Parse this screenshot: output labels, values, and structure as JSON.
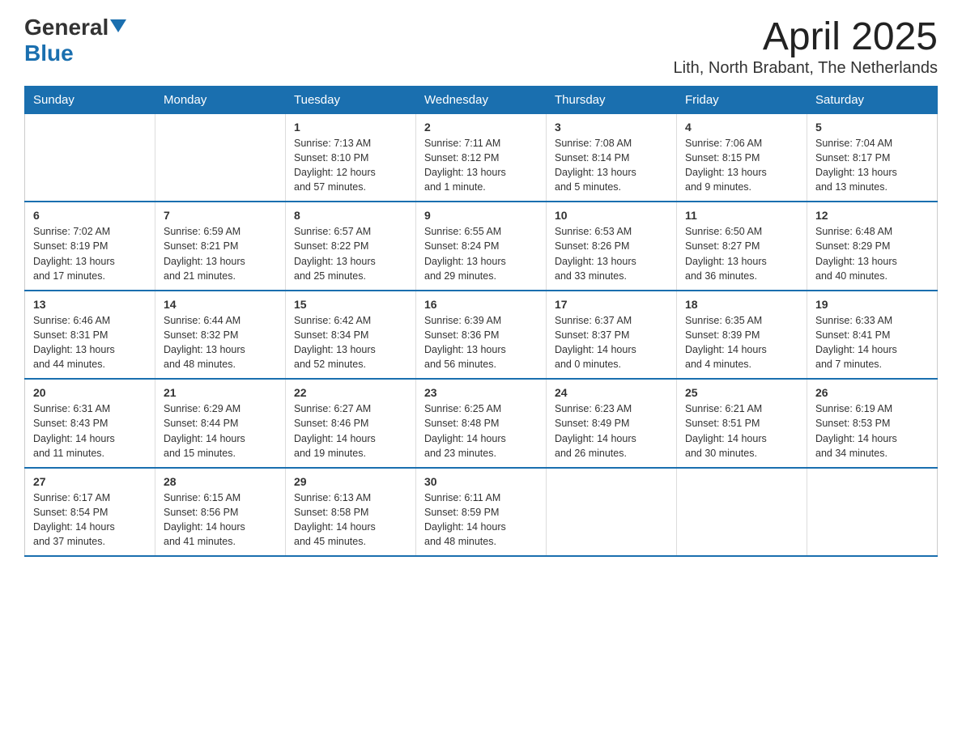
{
  "header": {
    "logo_general": "General",
    "logo_blue": "Blue",
    "title": "April 2025",
    "subtitle": "Lith, North Brabant, The Netherlands"
  },
  "days_of_week": [
    "Sunday",
    "Monday",
    "Tuesday",
    "Wednesday",
    "Thursday",
    "Friday",
    "Saturday"
  ],
  "weeks": [
    [
      {
        "day": "",
        "info": ""
      },
      {
        "day": "",
        "info": ""
      },
      {
        "day": "1",
        "info": "Sunrise: 7:13 AM\nSunset: 8:10 PM\nDaylight: 12 hours\nand 57 minutes."
      },
      {
        "day": "2",
        "info": "Sunrise: 7:11 AM\nSunset: 8:12 PM\nDaylight: 13 hours\nand 1 minute."
      },
      {
        "day": "3",
        "info": "Sunrise: 7:08 AM\nSunset: 8:14 PM\nDaylight: 13 hours\nand 5 minutes."
      },
      {
        "day": "4",
        "info": "Sunrise: 7:06 AM\nSunset: 8:15 PM\nDaylight: 13 hours\nand 9 minutes."
      },
      {
        "day": "5",
        "info": "Sunrise: 7:04 AM\nSunset: 8:17 PM\nDaylight: 13 hours\nand 13 minutes."
      }
    ],
    [
      {
        "day": "6",
        "info": "Sunrise: 7:02 AM\nSunset: 8:19 PM\nDaylight: 13 hours\nand 17 minutes."
      },
      {
        "day": "7",
        "info": "Sunrise: 6:59 AM\nSunset: 8:21 PM\nDaylight: 13 hours\nand 21 minutes."
      },
      {
        "day": "8",
        "info": "Sunrise: 6:57 AM\nSunset: 8:22 PM\nDaylight: 13 hours\nand 25 minutes."
      },
      {
        "day": "9",
        "info": "Sunrise: 6:55 AM\nSunset: 8:24 PM\nDaylight: 13 hours\nand 29 minutes."
      },
      {
        "day": "10",
        "info": "Sunrise: 6:53 AM\nSunset: 8:26 PM\nDaylight: 13 hours\nand 33 minutes."
      },
      {
        "day": "11",
        "info": "Sunrise: 6:50 AM\nSunset: 8:27 PM\nDaylight: 13 hours\nand 36 minutes."
      },
      {
        "day": "12",
        "info": "Sunrise: 6:48 AM\nSunset: 8:29 PM\nDaylight: 13 hours\nand 40 minutes."
      }
    ],
    [
      {
        "day": "13",
        "info": "Sunrise: 6:46 AM\nSunset: 8:31 PM\nDaylight: 13 hours\nand 44 minutes."
      },
      {
        "day": "14",
        "info": "Sunrise: 6:44 AM\nSunset: 8:32 PM\nDaylight: 13 hours\nand 48 minutes."
      },
      {
        "day": "15",
        "info": "Sunrise: 6:42 AM\nSunset: 8:34 PM\nDaylight: 13 hours\nand 52 minutes."
      },
      {
        "day": "16",
        "info": "Sunrise: 6:39 AM\nSunset: 8:36 PM\nDaylight: 13 hours\nand 56 minutes."
      },
      {
        "day": "17",
        "info": "Sunrise: 6:37 AM\nSunset: 8:37 PM\nDaylight: 14 hours\nand 0 minutes."
      },
      {
        "day": "18",
        "info": "Sunrise: 6:35 AM\nSunset: 8:39 PM\nDaylight: 14 hours\nand 4 minutes."
      },
      {
        "day": "19",
        "info": "Sunrise: 6:33 AM\nSunset: 8:41 PM\nDaylight: 14 hours\nand 7 minutes."
      }
    ],
    [
      {
        "day": "20",
        "info": "Sunrise: 6:31 AM\nSunset: 8:43 PM\nDaylight: 14 hours\nand 11 minutes."
      },
      {
        "day": "21",
        "info": "Sunrise: 6:29 AM\nSunset: 8:44 PM\nDaylight: 14 hours\nand 15 minutes."
      },
      {
        "day": "22",
        "info": "Sunrise: 6:27 AM\nSunset: 8:46 PM\nDaylight: 14 hours\nand 19 minutes."
      },
      {
        "day": "23",
        "info": "Sunrise: 6:25 AM\nSunset: 8:48 PM\nDaylight: 14 hours\nand 23 minutes."
      },
      {
        "day": "24",
        "info": "Sunrise: 6:23 AM\nSunset: 8:49 PM\nDaylight: 14 hours\nand 26 minutes."
      },
      {
        "day": "25",
        "info": "Sunrise: 6:21 AM\nSunset: 8:51 PM\nDaylight: 14 hours\nand 30 minutes."
      },
      {
        "day": "26",
        "info": "Sunrise: 6:19 AM\nSunset: 8:53 PM\nDaylight: 14 hours\nand 34 minutes."
      }
    ],
    [
      {
        "day": "27",
        "info": "Sunrise: 6:17 AM\nSunset: 8:54 PM\nDaylight: 14 hours\nand 37 minutes."
      },
      {
        "day": "28",
        "info": "Sunrise: 6:15 AM\nSunset: 8:56 PM\nDaylight: 14 hours\nand 41 minutes."
      },
      {
        "day": "29",
        "info": "Sunrise: 6:13 AM\nSunset: 8:58 PM\nDaylight: 14 hours\nand 45 minutes."
      },
      {
        "day": "30",
        "info": "Sunrise: 6:11 AM\nSunset: 8:59 PM\nDaylight: 14 hours\nand 48 minutes."
      },
      {
        "day": "",
        "info": ""
      },
      {
        "day": "",
        "info": ""
      },
      {
        "day": "",
        "info": ""
      }
    ]
  ]
}
